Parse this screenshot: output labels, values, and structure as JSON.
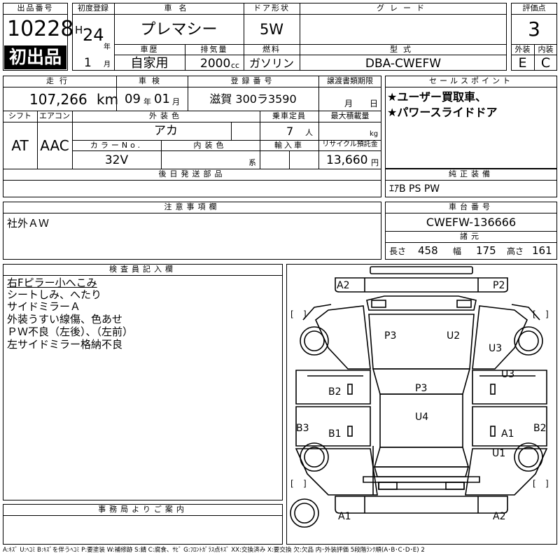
{
  "header": {
    "lot_number_label": "出品番号",
    "lot_number": "10228",
    "first_listing": "初出品",
    "first_reg_label": "初度登録",
    "era": "H",
    "year": "24",
    "year_unit": "年",
    "month": "1",
    "month_unit": "月",
    "car_name_label": "車名",
    "car_name": "プレマシー",
    "door_label": "ドア形状",
    "door": "5W",
    "grade_label": "グレード",
    "grade": "",
    "score_label": "評価点",
    "score": "3",
    "history_label": "車歴",
    "history": "自家用",
    "displacement_label": "排気量",
    "displacement": "2000",
    "displacement_unit": "cc",
    "fuel_label": "燃料",
    "fuel": "ガソリン",
    "model_label": "型式",
    "model": "DBA-CWEFW",
    "exterior_label": "外装",
    "exterior": "E",
    "interior_label": "内装",
    "interior": "C"
  },
  "row2": {
    "mileage_label": "走行",
    "mileage": "107,266",
    "mileage_unit": "km",
    "inspection_label": "車検",
    "insp_year": "09",
    "insp_year_unit": "年",
    "insp_month": "01",
    "insp_month_unit": "月",
    "reg_no_label": "登録番号",
    "reg_no": "滋賀 300ラ3590",
    "deadline_label": "譲渡書類期限",
    "deadline_month_unit": "月",
    "deadline_day_unit": "日",
    "shift_label": "シフト",
    "shift": "AT",
    "ac_label": "エアコン",
    "ac": "AAC",
    "color_label": "外装色",
    "color": "アカ",
    "capacity_label": "乗車定員",
    "capacity": "7",
    "capacity_unit": "人",
    "load_label": "最大積載量",
    "load_unit": "kg",
    "color_no_label": "カラーNo.",
    "color_no": "32V",
    "interior_color_label": "内装色",
    "interior_color_unit": "系",
    "import_label": "輸入車",
    "recycle_label": "リサイクル預託金",
    "recycle": "13,660",
    "recycle_unit": "円",
    "later_parts_label": "後日発送部品"
  },
  "sales": {
    "label": "セールスポイント",
    "lines": [
      "★ユーザー買取車、",
      "★パワースライドドア"
    ]
  },
  "equipment": {
    "label": "純正装備",
    "value": "ｴｱB PS PW"
  },
  "caution": {
    "label": "注意事項欄",
    "value": "社外ＡＷ"
  },
  "chassis": {
    "label": "車台番号",
    "value": "CWEFW-136666",
    "dims_label": "諸元",
    "length_label": "長さ",
    "length": "458",
    "width_label": "幅",
    "width": "175",
    "height_label": "高さ",
    "height": "161"
  },
  "inspector": {
    "label": "検査員記入欄",
    "lines": [
      "右Fピラー小へこみ",
      "シートしみ、へたり",
      "サイドミラーＡ",
      "外装うすい線傷、色あせ",
      "ＰＷ不良（左後）、（左前）",
      "左サイドミラー格納不良"
    ]
  },
  "office": {
    "label": "事務局よりご案内"
  },
  "diagram": {
    "marks": {
      "a2_top_left": "A2",
      "p2_top_right": "P2",
      "p3_hood": "P3",
      "u2_hood": "U2",
      "u3_right_fender": "U3",
      "u3_right_front_door": "U3",
      "b2_left_front_door": "B2",
      "p3_roof": "P3",
      "u4_roof": "U4",
      "b3_left_side": "B3",
      "b2_right_side": "B2",
      "b1_left_rear_door": "B1",
      "a1_right_rear_door": "A1",
      "u1_right_quarter": "U1",
      "a1_rear_left": "A1",
      "a2_rear_right": "A2"
    }
  },
  "legend": "A:ｷｽﾞ U:ﾍｺﾐ B:ｷｽﾞを伴うﾍｺﾐ P:要塗装 W:補修跡 S:錆 C:腐食、ｻﾋﾞ G:ﾌﾛﾝﾄｶﾞﾗｽ点ｷｽﾞ XX:交換済み X:要交換 欠:欠品 内･外装評価 5段階ﾗﾝｸ順(A･B･C･D･E) 2"
}
